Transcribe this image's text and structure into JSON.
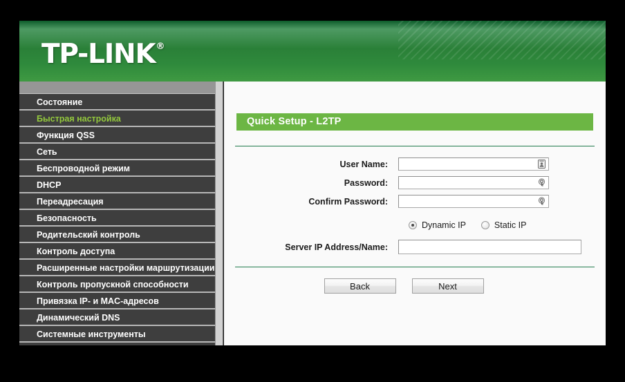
{
  "brand": {
    "logo_text": "TP-LINK",
    "registered_mark": "®"
  },
  "colors": {
    "header_green_dark": "#0d5c2b",
    "header_green_light": "#3f9a42",
    "title_bar_green": "#6cb644",
    "active_menu_green": "#93c83d",
    "sidebar_bg": "#3e3e3e",
    "rule_green": "#1f7a4a"
  },
  "sidebar": {
    "items": [
      {
        "label": "Состояние",
        "active": false
      },
      {
        "label": "Быстрая настройка",
        "active": true
      },
      {
        "label": "Функция QSS",
        "active": false
      },
      {
        "label": "Сеть",
        "active": false
      },
      {
        "label": "Беспроводной режим",
        "active": false
      },
      {
        "label": "DHCP",
        "active": false
      },
      {
        "label": "Переадресация",
        "active": false
      },
      {
        "label": "Безопасность",
        "active": false
      },
      {
        "label": "Родительский контроль",
        "active": false
      },
      {
        "label": "Контроль доступа",
        "active": false
      },
      {
        "label": "Расширенные настройки маршрутизации",
        "active": false
      },
      {
        "label": "Контроль пропускной способности",
        "active": false
      },
      {
        "label": "Привязка IP- и MAC-адресов",
        "active": false
      },
      {
        "label": "Динамический DNS",
        "active": false
      },
      {
        "label": "Системные инструменты",
        "active": false
      }
    ]
  },
  "main": {
    "title": "Quick Setup - L2TP",
    "fields": [
      {
        "label": "User Name:",
        "value": "",
        "icon": "contact-card-icon"
      },
      {
        "label": "Password:",
        "value": "",
        "icon": "key-icon"
      },
      {
        "label": "Confirm Password:",
        "value": "",
        "icon": "key-icon"
      }
    ],
    "ip_mode": {
      "options": [
        {
          "label": "Dynamic IP",
          "selected": true
        },
        {
          "label": "Static IP",
          "selected": false
        }
      ]
    },
    "server_field": {
      "label": "Server IP Address/Name:",
      "value": ""
    },
    "buttons": {
      "back": "Back",
      "next": "Next"
    }
  }
}
